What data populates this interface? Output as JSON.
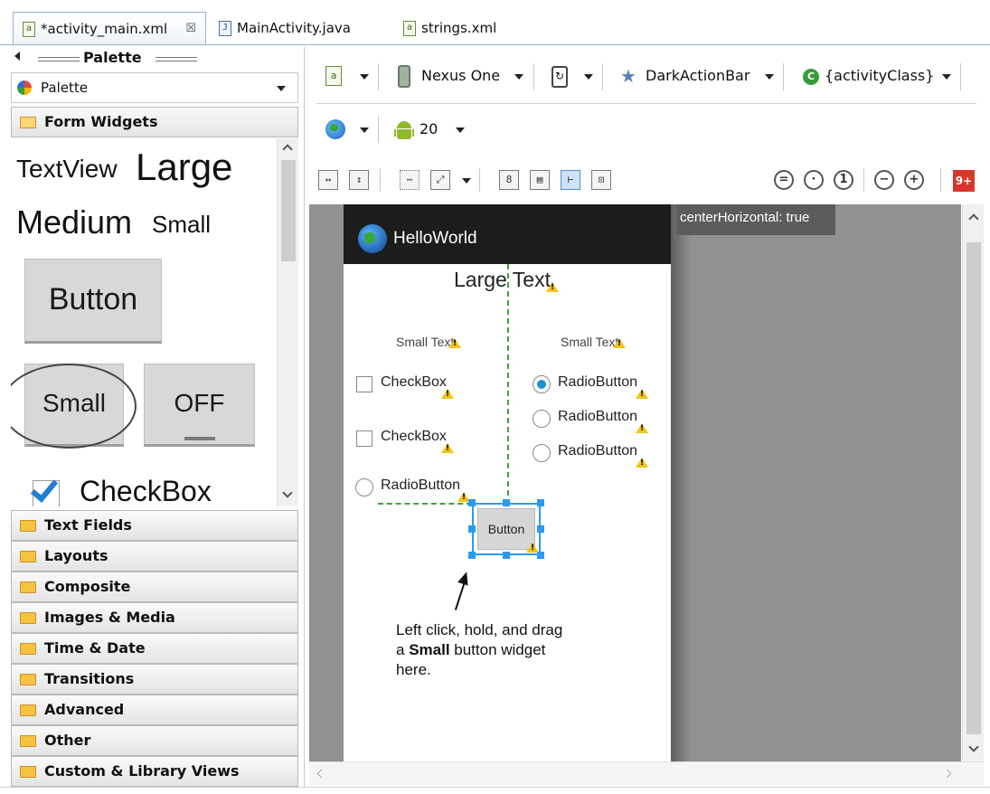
{
  "tabs": [
    {
      "label": "*activity_main.xml",
      "close": "☒",
      "icon": "xml-file-icon",
      "icon_glyph": "a"
    },
    {
      "label": "MainActivity.java",
      "icon": "java-file-icon",
      "icon_glyph": "J"
    },
    {
      "label": "strings.xml",
      "icon": "xml-file-icon",
      "icon_glyph": "a"
    }
  ],
  "palette": {
    "header": "Palette",
    "selector": "Palette",
    "open_category": "Form Widgets",
    "widgets": {
      "textview": "TextView",
      "large": "Large",
      "medium": "Medium",
      "small": "Small",
      "button": "Button",
      "small_button": "Small",
      "toggle": "OFF",
      "checkbox": "CheckBox"
    },
    "categories": [
      "Text Fields",
      "Layouts",
      "Composite",
      "Images & Media",
      "Time & Date",
      "Transitions",
      "Advanced",
      "Other",
      "Custom & Library Views"
    ]
  },
  "toolbar": {
    "device": "Nexus One",
    "theme": "DarkActionBar",
    "activity": "{activityClass}",
    "api_level": "20",
    "notification_badge": "9+"
  },
  "tooltip": "centerHorizontal: true",
  "preview": {
    "app_title": "HelloWorld",
    "large_text": "Large Text",
    "small_text_left": "Small Text",
    "small_text_right": "Small Text",
    "checkbox_1": "CheckBox",
    "checkbox_2": "CheckBox",
    "radio_left": "RadioButton",
    "radio_1": "RadioButton",
    "radio_2": "RadioButton",
    "radio_3": "RadioButton",
    "button": "Button"
  },
  "annotation": {
    "line1": "Left click, hold, and drag",
    "line2_prefix": "a ",
    "line2_bold": "Small",
    "line2_suffix": " button widget",
    "line3": "here."
  },
  "colors": {
    "selection": "#2a9bf0",
    "guide": "#3aa637",
    "badge": "#d9352a",
    "warning": "#f2c417"
  }
}
